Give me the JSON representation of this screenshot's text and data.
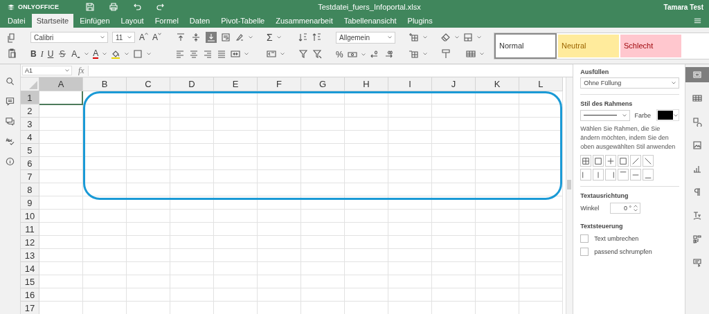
{
  "header": {
    "logo": "ONLYOFFICE",
    "file_title": "Testdatei_fuers_Infoportal.xlsx",
    "user": "Tamara Test"
  },
  "tabs": [
    {
      "label": "Datei",
      "selected": false
    },
    {
      "label": "Startseite",
      "selected": true
    },
    {
      "label": "Einfügen",
      "selected": false
    },
    {
      "label": "Layout",
      "selected": false
    },
    {
      "label": "Formel",
      "selected": false
    },
    {
      "label": "Daten",
      "selected": false
    },
    {
      "label": "Pivot-Tabelle",
      "selected": false
    },
    {
      "label": "Zusammenarbeit",
      "selected": false
    },
    {
      "label": "Tabellenansicht",
      "selected": false
    },
    {
      "label": "Plugins",
      "selected": false
    }
  ],
  "toolbar": {
    "font_name": "Calibri",
    "font_size": "11",
    "grow_font": "A",
    "shrink_font": "A",
    "bold": "B",
    "italic": "I",
    "underline": "U",
    "subscript": "A",
    "font_color": "A",
    "vertical_align": [
      {
        "selected": false
      },
      {
        "selected": false
      },
      {
        "selected": true
      }
    ],
    "sum": "Σ",
    "number_format": "Allgemein",
    "percent": "%",
    "styles": [
      {
        "label": "Normal",
        "kind": "normal"
      },
      {
        "label": "Neutral",
        "kind": "neutral"
      },
      {
        "label": "Schlecht",
        "kind": "bad"
      }
    ]
  },
  "formula_bar": {
    "cell_ref": "A1",
    "fx": "fx"
  },
  "sheet": {
    "columns": [
      {
        "label": "A",
        "selected": true
      },
      {
        "label": "B",
        "selected": false
      },
      {
        "label": "C",
        "selected": false
      },
      {
        "label": "D",
        "selected": false
      },
      {
        "label": "E",
        "selected": false
      },
      {
        "label": "F",
        "selected": false
      },
      {
        "label": "G",
        "selected": false
      },
      {
        "label": "H",
        "selected": false
      },
      {
        "label": "I",
        "selected": false
      },
      {
        "label": "J",
        "selected": false
      },
      {
        "label": "K",
        "selected": false
      },
      {
        "label": "L",
        "selected": false
      }
    ],
    "rows": [
      {
        "label": "1",
        "selected": true
      },
      {
        "label": "2",
        "selected": false
      },
      {
        "label": "3",
        "selected": false
      },
      {
        "label": "4",
        "selected": false
      },
      {
        "label": "5",
        "selected": false
      },
      {
        "label": "6",
        "selected": false
      },
      {
        "label": "7",
        "selected": false
      },
      {
        "label": "8",
        "selected": false
      },
      {
        "label": "9",
        "selected": false
      },
      {
        "label": "10",
        "selected": false
      },
      {
        "label": "11",
        "selected": false
      },
      {
        "label": "12",
        "selected": false
      },
      {
        "label": "13",
        "selected": false
      },
      {
        "label": "14",
        "selected": false
      },
      {
        "label": "15",
        "selected": false
      },
      {
        "label": "16",
        "selected": false
      },
      {
        "label": "17",
        "selected": false
      }
    ]
  },
  "panel": {
    "fill_heading": "Ausfüllen",
    "fill_value": "Ohne Füllung",
    "border_heading": "Stil des Rahmens",
    "color_label": "Farbe",
    "border_hint": "Wählen Sie Rahmen, die Sie ändern möchten, indem Sie den oben ausgewählten Stil anwenden",
    "orientation_heading": "Textausrichtung",
    "angle_label": "Winkel",
    "angle_value": "0 °",
    "control_heading": "Textsteuerung",
    "options": [
      {
        "label": "Text umbrechen",
        "checked": false
      },
      {
        "label": "passend schrumpfen",
        "checked": false
      }
    ]
  },
  "right_tabs": [
    {
      "selected": true
    },
    {
      "selected": false
    },
    {
      "selected": false
    },
    {
      "selected": false
    },
    {
      "selected": false
    },
    {
      "selected": false
    },
    {
      "selected": false
    },
    {
      "selected": false
    },
    {
      "selected": false
    }
  ]
}
